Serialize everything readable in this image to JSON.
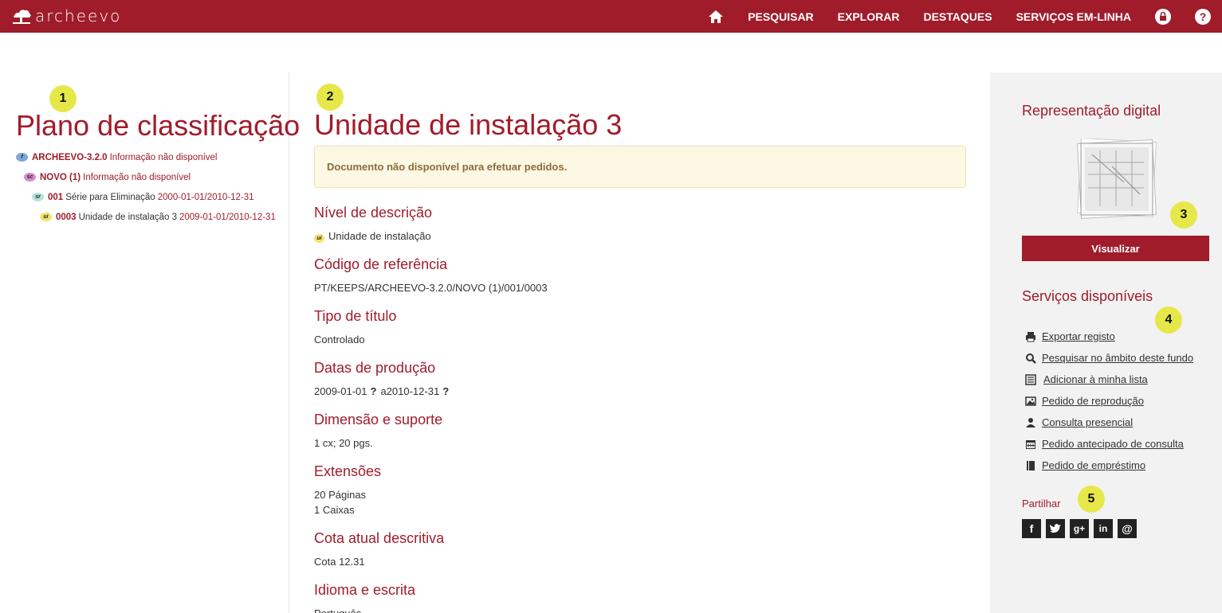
{
  "header": {
    "logo_text": "archeevo",
    "nav": {
      "search": "PESQUISAR",
      "explore": "EXPLORAR",
      "highlights": "DESTAQUES",
      "services": "SERVIÇOS EM-LINHA"
    }
  },
  "badges": [
    "1",
    "2",
    "3",
    "4",
    "5"
  ],
  "left": {
    "title": "Plano de classificação",
    "tree": [
      {
        "level": "f",
        "code": "ARCHEEVO-3.2.0",
        "title": "",
        "date": "Informação não disponível"
      },
      {
        "level": "sc",
        "code": "NOVO (1)",
        "title": "",
        "date": "Informação não disponível"
      },
      {
        "level": "sr",
        "code": "001",
        "title": "Série para Eliminação",
        "date": "2000-01-01/2010-12-31"
      },
      {
        "level": "ui",
        "code": "0003",
        "title": "Unidade de instalação 3",
        "date": "2009-01-01/2010-12-31"
      }
    ]
  },
  "main": {
    "title": "Unidade de instalação 3",
    "alert": "Documento não disponível para efetuar pedidos.",
    "fields": {
      "level_label": "Nível de descrição",
      "level_value": "Unidade de instalação",
      "ref_label": "Código de referência",
      "ref_value": "PT/KEEPS/ARCHEEVO-3.2.0/NOVO (1)/001/0003",
      "title_type_label": "Tipo de título",
      "title_type_value": "Controlado",
      "dates_label": "Datas de produção",
      "date_start": "2009-01-01",
      "date_q1": "?",
      "date_sep": "a",
      "date_end": "2010-12-31",
      "date_q2": "?",
      "dimension_label": "Dimensão e suporte",
      "dimension_value": "1 cx; 20 pgs.",
      "extensions_label": "Extensões",
      "extension_1": "20 Páginas",
      "extension_2": "1 Caixas",
      "call_label": "Cota atual descritiva",
      "call_value": "Cota 12.31",
      "language_label": "Idioma e escrita",
      "language_value": "Português"
    }
  },
  "sidebar": {
    "digital_title": "Representação digital",
    "view_button": "Visualizar",
    "services_title": "Serviços disponíveis",
    "services": [
      {
        "icon": "print-icon",
        "label": "Exportar registo"
      },
      {
        "icon": "search-icon",
        "label": "Pesquisar no âmbito deste fundo"
      },
      {
        "icon": "list-icon",
        "label": "Adicionar à minha lista"
      },
      {
        "icon": "image-icon",
        "label": "Pedido de reprodução"
      },
      {
        "icon": "user-icon",
        "label": "Consulta presencial"
      },
      {
        "icon": "calendar-icon",
        "label": "Pedido antecipado de consulta"
      },
      {
        "icon": "book-icon",
        "label": "Pedido de empréstimo"
      }
    ],
    "share_title": "Partilhar",
    "share": {
      "facebook": "f",
      "google": "g+",
      "linkedin": "in",
      "email": "@"
    }
  },
  "colors": {
    "brand": "#a01c2b",
    "badge": "#e6e84a",
    "alert_bg": "#fcf8e3",
    "sidebar_bg": "#f2f2f2"
  }
}
